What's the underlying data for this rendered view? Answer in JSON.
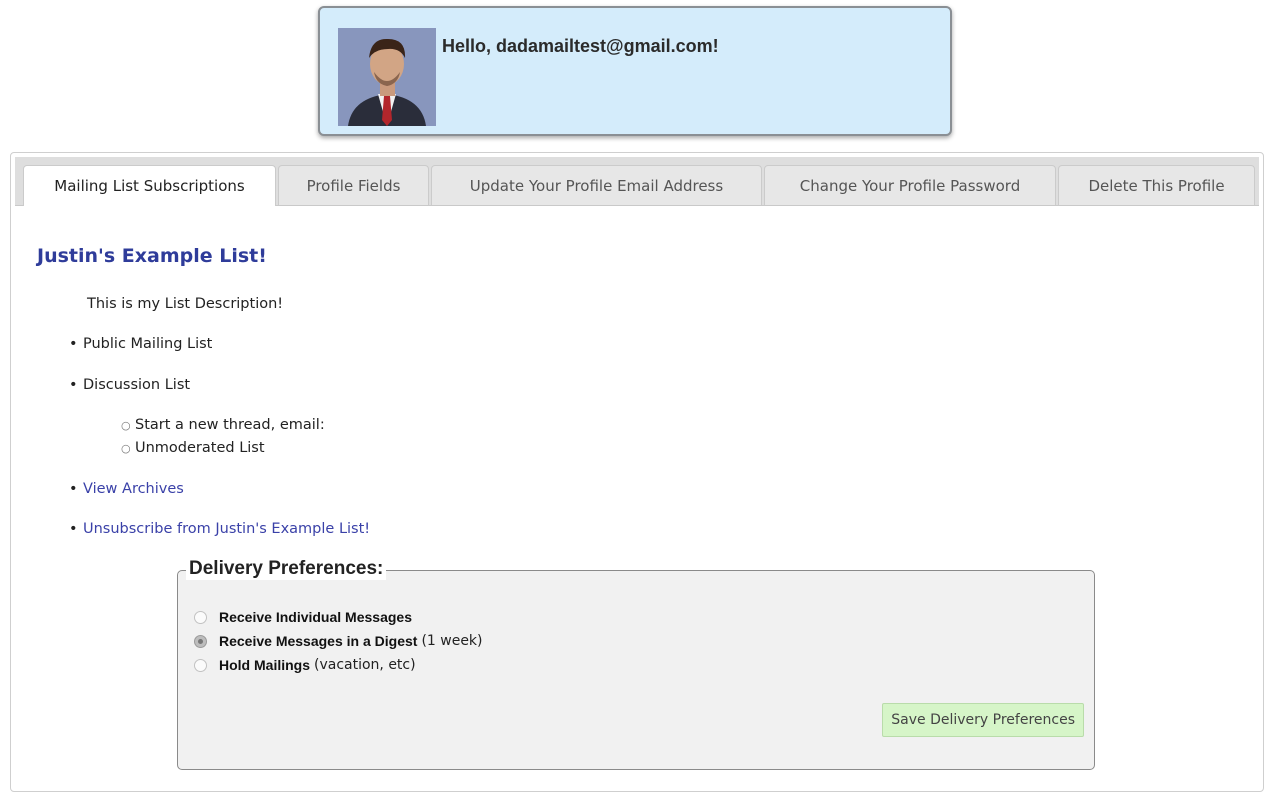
{
  "greeting": {
    "text": "Hello, dadamailtest@gmail.com!"
  },
  "tabs": [
    {
      "label": "Mailing List Subscriptions",
      "active": true
    },
    {
      "label": "Profile Fields",
      "active": false
    },
    {
      "label": "Update Your Profile Email Address",
      "active": false
    },
    {
      "label": "Change Your Profile Password",
      "active": false
    },
    {
      "label": "Delete This Profile",
      "active": false
    }
  ],
  "list": {
    "title": "Justin's Example List!",
    "description": "This is my List Description!",
    "items": {
      "public": "Public Mailing List",
      "discussion": "Discussion List",
      "discussion_sub": [
        "Start a new thread, email:",
        "Unmoderated List"
      ],
      "archives": "View Archives",
      "unsubscribe": "Unsubscribe from Justin's Example List!"
    }
  },
  "delivery": {
    "legend": "Delivery Preferences:",
    "options": [
      {
        "label": "Receive Individual Messages",
        "note": "",
        "checked": false
      },
      {
        "label": "Receive Messages in a Digest",
        "note": "(1 week)",
        "checked": true
      },
      {
        "label": "Hold Mailings",
        "note": "(vacation, etc)",
        "checked": false
      }
    ],
    "save_label": "Save Delivery Preferences"
  },
  "colors": {
    "link": "#3a41a8",
    "title": "#2f3c9a",
    "greeting_bg": "#d4ecfb",
    "save_button_bg": "#d6f5c8"
  }
}
